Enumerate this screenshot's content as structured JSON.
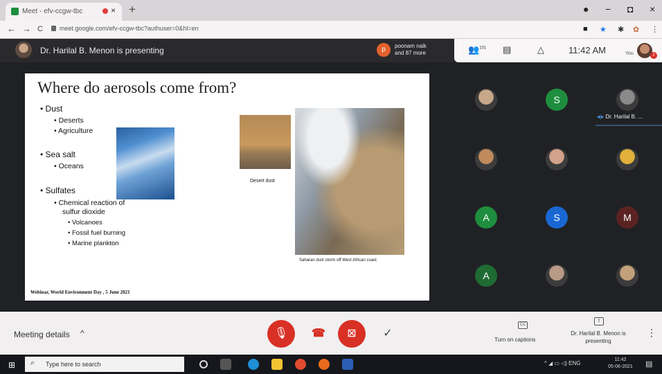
{
  "browser": {
    "tab_title": "Meet - efv-ccgw-tbc",
    "tab_close": "×",
    "new_tab": "+",
    "url": "meet.google.com/efv-ccgw-tbc?authuser=0&hl=en",
    "back": "←",
    "forward": "→",
    "reload": "C",
    "window_controls": {
      "menu": "●",
      "minimize": "−",
      "maximize": "◘",
      "close": "×"
    },
    "extensions": [
      "■",
      "★",
      "✱",
      "✿",
      "⋮"
    ]
  },
  "meet": {
    "presenter_text": "Dr. Harilal B. Menon is presenting",
    "more_participants_initial": "p",
    "more_participants_text": [
      "poonam naik",
      "and 87 more"
    ],
    "people_count": "101",
    "clock": "11:42 AM",
    "you_label": "You",
    "you_badge": "2",
    "speaking_label": "Dr. Harilal B. ...",
    "speaking_icon": "◂|▸"
  },
  "slide": {
    "title": "Where do aerosols come from?",
    "bullets": [
      {
        "text": "• Dust",
        "level": 1
      },
      {
        "text": "• Deserts",
        "level": 2
      },
      {
        "text": "• Agriculture",
        "level": 2
      },
      {
        "text": "• Sea salt",
        "level": 1
      },
      {
        "text": "• Oceans",
        "level": 2
      },
      {
        "text": "• Sulfates",
        "level": 1
      },
      {
        "text": "• Chemical reaction of",
        "level": 2
      },
      {
        "text": "sulfur dioxide",
        "level": 2
      },
      {
        "text": "• Volcanoes",
        "level": 3
      },
      {
        "text": "• Fossil fuel burning",
        "level": 3
      },
      {
        "text": "• Marine plankton",
        "level": 3
      }
    ],
    "desert_caption": "Desert dust",
    "satellite_caption": "Saharan dust storm off West African coast",
    "footer": "Webinar, World Environment Day , 5 June 2021"
  },
  "participants": [
    {
      "initial": "",
      "color": "#c7a889",
      "kind": "photo"
    },
    {
      "initial": "S",
      "color": "#1e8e3e",
      "kind": "letter"
    },
    {
      "initial": "",
      "color": "#8a8a8a",
      "kind": "photo"
    },
    {
      "initial": "",
      "color": "#c08a5c",
      "kind": "photo"
    },
    {
      "initial": "",
      "color": "#d2a28a",
      "kind": "photo"
    },
    {
      "initial": "",
      "color": "#e0b03a",
      "kind": "photo"
    },
    {
      "initial": "A",
      "color": "#1e8e3e",
      "kind": "letter"
    },
    {
      "initial": "S",
      "color": "#1967d2",
      "kind": "letter"
    },
    {
      "initial": "M",
      "color": "#5b2222",
      "kind": "letter"
    },
    {
      "initial": "A",
      "color": "#1e6b34",
      "kind": "letter"
    },
    {
      "initial": "",
      "color": "#b89a86",
      "kind": "photo"
    },
    {
      "initial": "",
      "color": "#c2a07a",
      "kind": "photo"
    }
  ],
  "controls": {
    "meeting_details": "Meeting details",
    "meeting_details_chevron": "^",
    "mic_icon": "🎙",
    "hangup_icon": "☎",
    "camera_icon": "⊠",
    "check_icon": "✓",
    "captions_icon": "CC",
    "captions_label": "Turn on captions",
    "present_icon": "⇧",
    "present_label": "Dr. Harilal B. Menon is presenting",
    "more_icon": "⋮"
  },
  "taskbar": {
    "start_icon": "⊞",
    "search_icon": "⌕",
    "search_placeholder": "Type here to search",
    "tray_text": "^ ◢ ▭ ◁) ENG",
    "time": "11:42",
    "date": "05-06-2021",
    "notification_icon": "▤"
  }
}
